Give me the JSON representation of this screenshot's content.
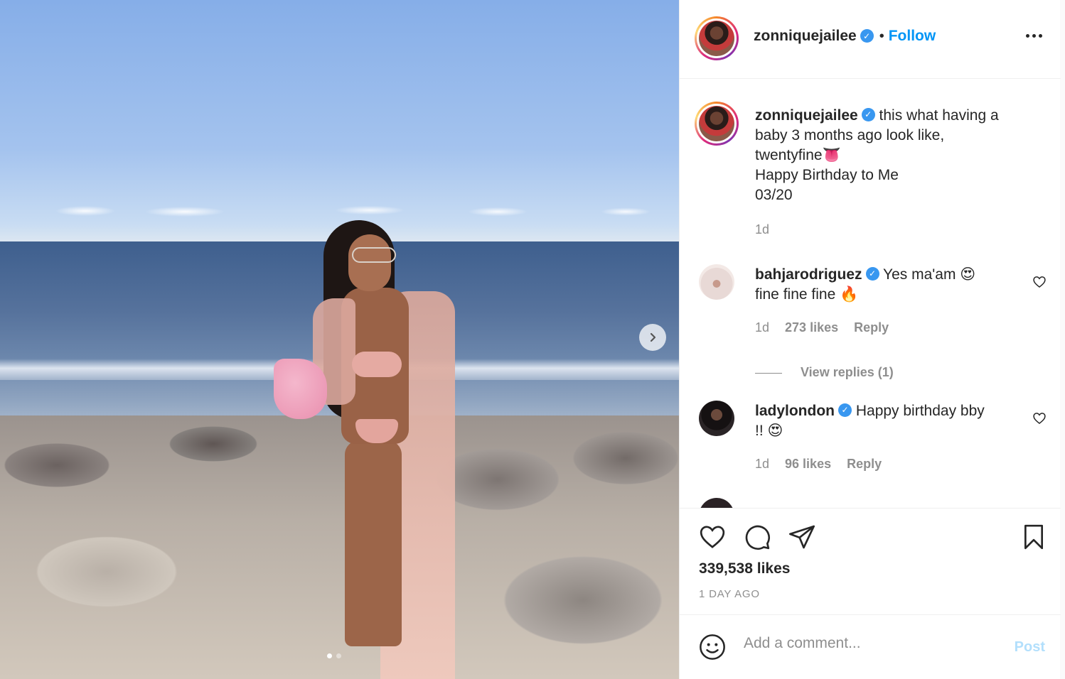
{
  "post": {
    "carousel": {
      "total": 2,
      "active": 0
    }
  },
  "header": {
    "username": "zonniquejailee",
    "separator": "•",
    "follow_label": "Follow"
  },
  "caption": {
    "username": "zonniquejailee",
    "line1": "this what having a",
    "line2": "baby 3 months ago look like,",
    "line3": "twentyfine👅",
    "line4": "Happy Birthday to Me",
    "line5": "03/20",
    "time": "1d"
  },
  "comments": [
    {
      "username": "bahjarodriguez",
      "text_line1": "Yes ma'am 😍",
      "text_line2": "fine fine fine 🔥",
      "time": "1d",
      "likes": "273 likes",
      "reply_label": "Reply",
      "view_replies": "View replies (1)"
    },
    {
      "username": "ladylondon",
      "text_line1": "Happy birthday bby",
      "text_line2": "!! 😍",
      "time": "1d",
      "likes": "96 likes",
      "reply_label": "Reply"
    }
  ],
  "actions": {
    "likes": "339,538 likes",
    "date": "1 DAY AGO"
  },
  "add_comment": {
    "placeholder": "Add a comment...",
    "post_label": "Post"
  },
  "colors": {
    "link_blue": "#0095f6",
    "verified_blue": "#3897f0",
    "post_disabled": "#b2dffc",
    "muted": "#8e8e8e"
  },
  "icons": [
    "chevron-right-icon",
    "more-icon",
    "verified-icon",
    "heart-icon",
    "comment-icon",
    "share-icon",
    "bookmark-icon",
    "emoji-icon"
  ]
}
